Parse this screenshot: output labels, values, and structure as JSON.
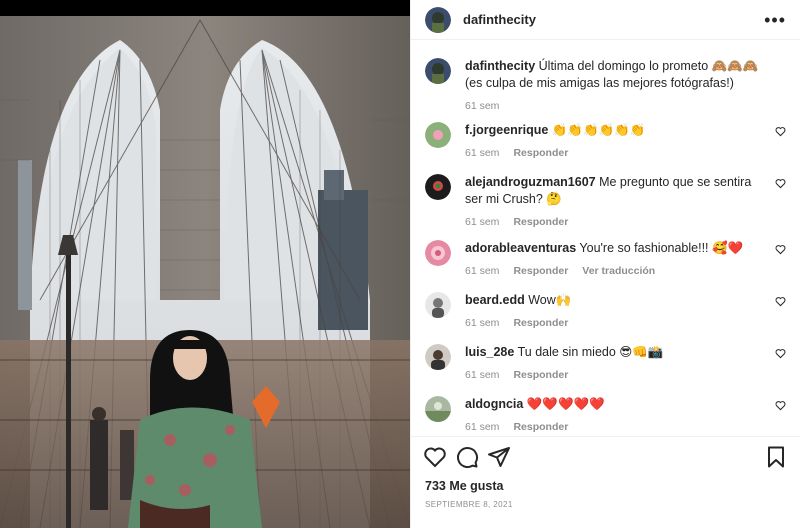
{
  "post": {
    "author": "dafinthecity",
    "caption": "Última del domingo lo prometo 🙈🙈🙈 (es culpa de mis amigas las mejores fotógrafas!)",
    "caption_time": "61 sem",
    "likes": "733 Me gusta",
    "date": "SEPTIEMBRE 8, 2021"
  },
  "labels": {
    "reply": "Responder",
    "see_translation": "Ver traducción"
  },
  "comments": [
    {
      "user": "f.jorgeenrique",
      "text": "👏👏👏👏👏👏",
      "time": "61 sem"
    },
    {
      "user": "alejandroguzman1607",
      "text": "Me pregunto que se sentira ser mi Crush? 🤔",
      "time": "61 sem"
    },
    {
      "user": "adorableaventuras",
      "text": "You're so fashionable!!! 🥰❤️",
      "time": "61 sem"
    },
    {
      "user": "beard.edd",
      "text": "Wow🙌",
      "time": "61 sem"
    },
    {
      "user": "luis_28e",
      "text": "Tu dale sin miedo 😎👊📸",
      "time": "61 sem"
    },
    {
      "user": "aldogncia",
      "text": "❤️❤️❤️❤️❤️",
      "time": "61 sem"
    }
  ],
  "icons": {
    "like": "heart-icon",
    "comment": "comment-icon",
    "share": "share-icon",
    "save": "bookmark-icon",
    "more": "more-options-icon"
  }
}
